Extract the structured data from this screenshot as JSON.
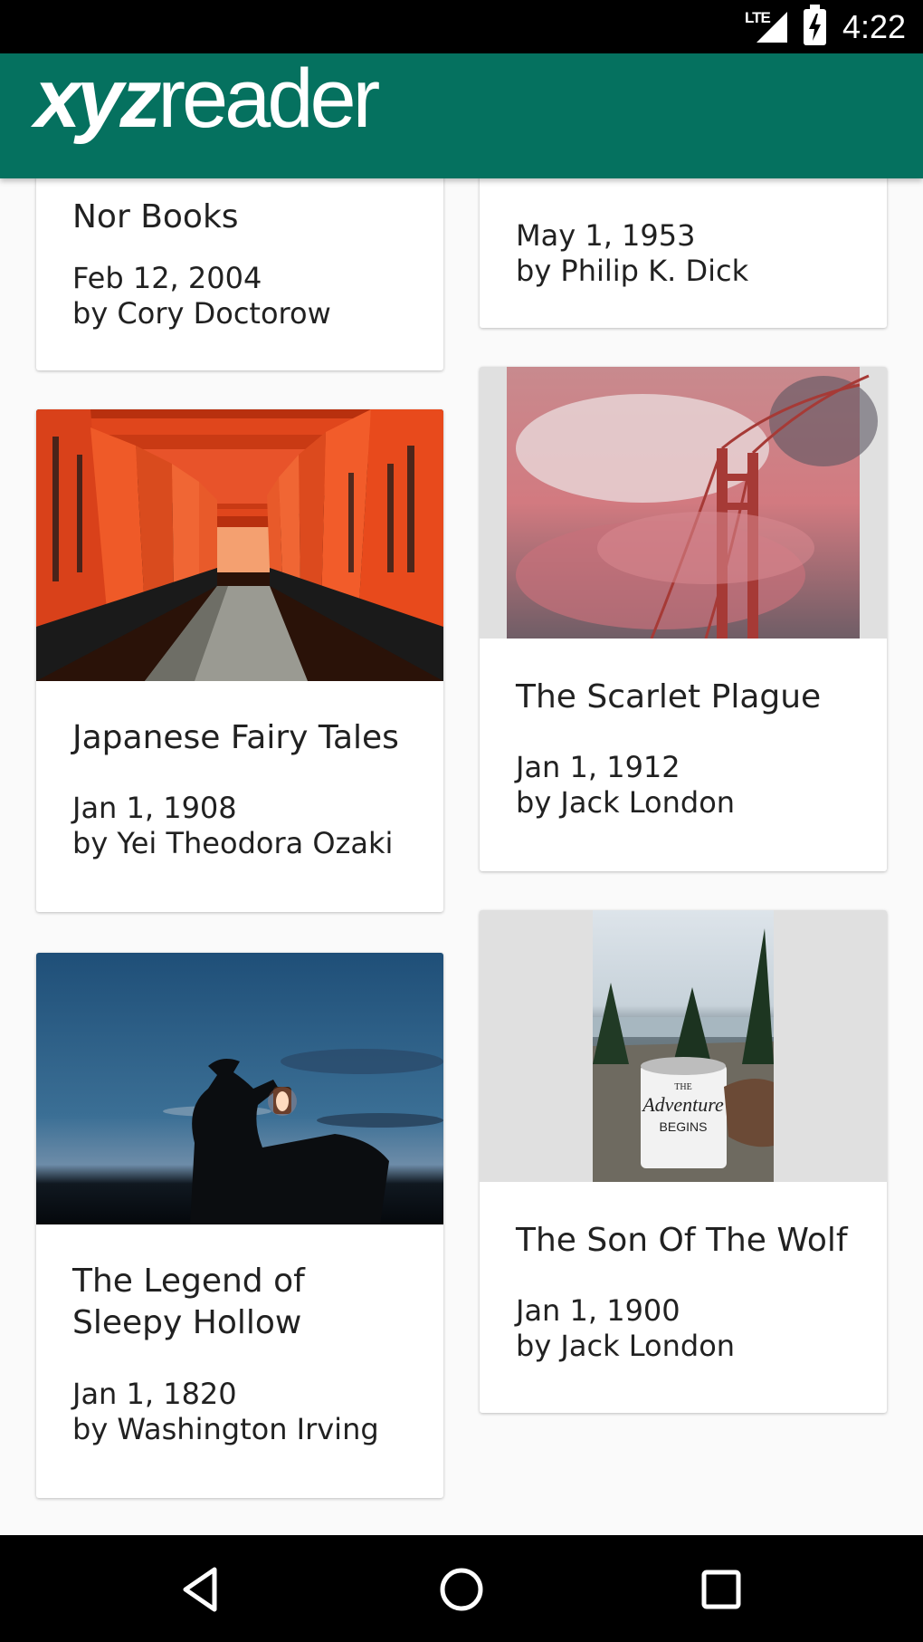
{
  "status_bar": {
    "network": "LTE",
    "time": "4:22",
    "icons": [
      "signal-icon",
      "battery-charging-icon"
    ]
  },
  "app_bar": {
    "logo_bold": "xyz",
    "logo_light": "reader"
  },
  "cards": [
    {
      "title": "Nor Books",
      "date": "Feb 12, 2004",
      "author": "by Cory Doctorow"
    },
    {
      "title": "",
      "date": "May 1, 1953",
      "author": "by Philip K. Dick"
    },
    {
      "title": "Japanese Fairy Tales",
      "date": "Jan 1, 1908",
      "author": "by Yei Theodora Ozaki",
      "image": "red-torii-gates-photo"
    },
    {
      "title": "The Scarlet Plague",
      "date": "Jan 1, 1912",
      "author": "by Jack London",
      "image": "golden-gate-bridge-fog-photo"
    },
    {
      "title_line1": "The Legend of",
      "title_line2": "Sleepy Hollow",
      "date": "Jan 1, 1820",
      "author": "by Washington Irving",
      "image": "rider-with-lantern-photo"
    },
    {
      "title": "The Son Of The Wolf",
      "date": "Jan 1, 1900",
      "author": "by Jack London",
      "image": "adventure-mug-photo",
      "mug_text_line1": "THE",
      "mug_text_line2": "Adventure",
      "mug_text_line3": "BEGINS"
    }
  ],
  "nav_bar": {
    "buttons": [
      "back-icon",
      "home-icon",
      "recents-icon"
    ]
  },
  "colors": {
    "primary": "#05715f",
    "background": "#fafafa",
    "card": "#ffffff"
  }
}
